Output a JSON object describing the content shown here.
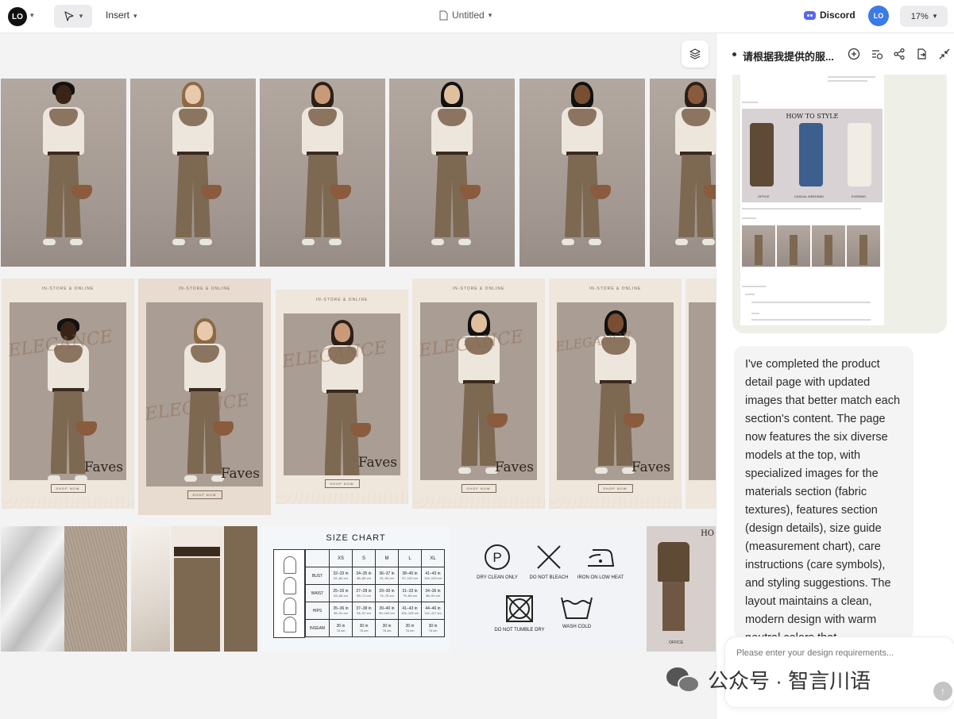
{
  "topbar": {
    "logo_text": "LO",
    "insert_label": "Insert",
    "doc_title": "Untitled",
    "discord_label": "Discord",
    "avatar_text": "LO",
    "zoom_label": "17%"
  },
  "canvas": {
    "posters": {
      "top_text": "IN-STORE & ONLINE",
      "elegance_text": "ELEGANCE",
      "faves_text": "Faves",
      "shop_text": "SHOP NOW"
    },
    "size_chart": {
      "title": "SIZE CHART",
      "sizes": [
        "XS",
        "S",
        "M",
        "L",
        "XL"
      ],
      "rows": [
        {
          "label": "BUST",
          "cells": [
            [
              "32–33 in",
              "81–84 cm"
            ],
            [
              "34–35 in",
              "86–89 cm"
            ],
            [
              "36–37 in",
              "91–94 cm"
            ],
            [
              "38–40 in",
              "97–102 cm"
            ],
            [
              "41–43 in",
              "104–109 cm"
            ]
          ]
        },
        {
          "label": "WAIST",
          "cells": [
            [
              "25–26 in",
              "63–66 cm"
            ],
            [
              "27–28 in",
              "69–71 cm"
            ],
            [
              "29–30 in",
              "74–76 cm"
            ],
            [
              "31–33 in",
              "79–84 cm"
            ],
            [
              "34–36 in",
              "86–91 cm"
            ]
          ]
        },
        {
          "label": "HIPS",
          "cells": [
            [
              "35–36 in",
              "89–91 cm"
            ],
            [
              "37–38 in",
              "94–97 cm"
            ],
            [
              "39–40 in",
              "99–102 cm"
            ],
            [
              "41–43 in",
              "104–109 cm"
            ],
            [
              "44–46 in",
              "112–117 cm"
            ]
          ]
        },
        {
          "label": "INSEAM",
          "cells": [
            [
              "30 in",
              "76 cm"
            ],
            [
              "30 in",
              "76 cm"
            ],
            [
              "30 in",
              "76 cm"
            ],
            [
              "30 in",
              "76 cm"
            ],
            [
              "30 in",
              "76 cm"
            ]
          ]
        }
      ]
    },
    "care": {
      "dry_clean": "DRY CLEAN ONLY",
      "no_bleach": "DO NOT BLEACH",
      "iron": "IRON ON LOW HEAT",
      "no_tumble": "DO NOT TUMBLE DRY",
      "wash": "WASH COLD"
    },
    "style_tile": {
      "heading": "HO",
      "label": "OFFICE"
    }
  },
  "panel": {
    "chat_title": "请根据我提供的服...",
    "preview": {
      "how_to_style_title": "HOW TO STYLE",
      "captions": [
        "OFFICE",
        "CASUAL WEEKEND",
        "EVENING"
      ]
    },
    "message": "I've completed the product detail page with updated images that better match each section's content. The page now features the six diverse models at the top, with specialized images for the materials section (fabric textures), features section (design details), size guide (measurement chart), care instructions (care symbols), and styling suggestions. The layout maintains a clean, modern design with warm neutral colors that",
    "input_placeholder": "Please enter your design requirements..."
  },
  "watermark": {
    "text": "公众号 · 智言川语"
  }
}
